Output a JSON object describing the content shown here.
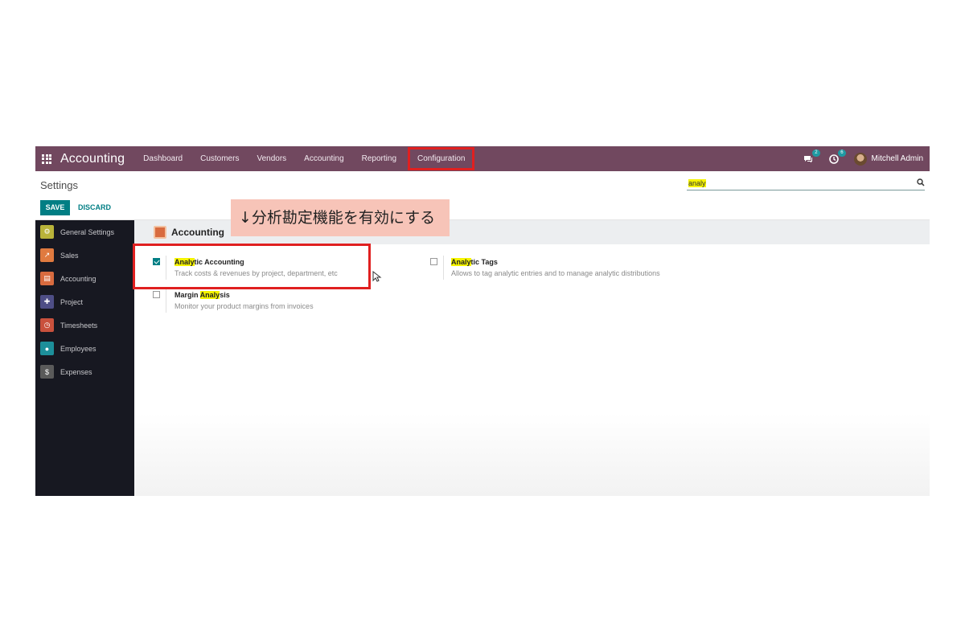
{
  "navbar": {
    "app_title": "Accounting",
    "menu": [
      {
        "label": "Dashboard"
      },
      {
        "label": "Customers"
      },
      {
        "label": "Vendors"
      },
      {
        "label": "Accounting"
      },
      {
        "label": "Reporting"
      },
      {
        "label": "Configuration"
      }
    ],
    "messages_badge": "2",
    "activity_badge": "6",
    "user_name": "Mitchell Admin",
    "accent": "#71485f"
  },
  "control_panel": {
    "breadcrumb": "Settings",
    "save_label": "SAVE",
    "discard_label": "DISCARD",
    "search_value": "analy"
  },
  "sidebar": {
    "items": [
      {
        "label": "General Settings",
        "icon": "gear-icon",
        "color": "#b9b33a"
      },
      {
        "label": "Sales",
        "icon": "chart-icon",
        "color": "#e07a3f"
      },
      {
        "label": "Accounting",
        "icon": "invoice-icon",
        "color": "#d86b3f"
      },
      {
        "label": "Project",
        "icon": "puzzle-icon",
        "color": "#4e4e86"
      },
      {
        "label": "Timesheets",
        "icon": "stopwatch-icon",
        "color": "#c9513d"
      },
      {
        "label": "Employees",
        "icon": "people-icon",
        "color": "#1d8f9a"
      },
      {
        "label": "Expenses",
        "icon": "expense-icon",
        "color": "#5a5a5a"
      }
    ]
  },
  "content": {
    "section_title": "Accounting",
    "settings": {
      "analytic_accounting": {
        "label_hl": "Analy",
        "label_rest": "tic Accounting",
        "description": "Track costs & revenues by project, department, etc",
        "checked": true
      },
      "analytic_tags": {
        "label_hl": "Analy",
        "label_rest": "tic Tags",
        "description": "Allows to tag analytic entries and to manage analytic distributions",
        "checked": false
      },
      "margin_analysis": {
        "label_pre": "Margin ",
        "label_hl": "Analy",
        "label_rest": "sis",
        "description": "Monitor your product margins from invoices",
        "checked": false
      }
    }
  },
  "annotation": {
    "text": "↓分析勘定機能を有効にする"
  }
}
